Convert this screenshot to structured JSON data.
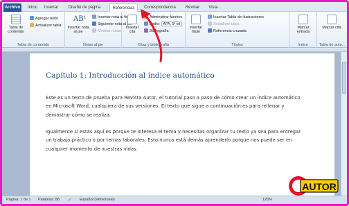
{
  "tabs": [
    {
      "label": "Archivo"
    },
    {
      "label": "Inicio"
    },
    {
      "label": "Insertar"
    },
    {
      "label": "Diseño de página"
    },
    {
      "label": "Referencias"
    },
    {
      "label": "Correspondencia"
    },
    {
      "label": "Revisar"
    },
    {
      "label": "Vista"
    }
  ],
  "ribbon": {
    "toc": {
      "group_label": "Tabla de contenido",
      "table_btn": "Tabla de contenido",
      "add_text": "Agregar texto",
      "update_table": "Actualizar tabla"
    },
    "footnotes": {
      "group_label": "Notas al pie",
      "insert_footnote": "Insertar nota al pie",
      "insert_endnote": "Insertar nota al final",
      "next_footnote": "Siguiente nota al pie",
      "show_notes": "Mostrar notas"
    },
    "citations": {
      "group_label": "Citas y bibliografía",
      "insert_citation": "Insertar cita",
      "manage_sources": "Administrar fuentes",
      "style_label": "Estilo:",
      "style_value": "APA, 5ª ed",
      "bibliography": "Bibliografía"
    },
    "captions": {
      "group_label": "Títulos",
      "insert_caption": "Insertar título",
      "insert_table_figures": "Insertar Tabla de ilustraciones",
      "update_table": "Actualizar tabla",
      "cross_ref": "Referencia cruzada"
    },
    "index": {
      "group_label": "Índice",
      "mark_entry": "Marcar entrada"
    },
    "authorities": {
      "group_label": "Tabla de auto...",
      "mark_citation": "Marcar cita"
    }
  },
  "document": {
    "heading": "Capítulo 1: Introducción al índice automático",
    "paragraphs": [
      "Este es un texto de prueba para Revista Autor, el tutorial paso a paso de cómo crear un índice automático en Microsoft Word, cualquiera de sus versiones. El texto que sigue a continuación es para rellenar y demostrar cómo se realiza.",
      "Igualmente si estás aquí es porque te interesa el tema y necesitas organizar tu texto ya sea para entregar un trabajo práctico o por temas laborales.  Esto nunca está demás aprenderlo porque nos puede ser en cualquier momento de nuestras vidas."
    ]
  },
  "status": {
    "page": "Página: 1 de 1",
    "words": "Palabras: 88",
    "language": "Español (Venezuela)",
    "zoom": "120%"
  },
  "logo": {
    "text": "AUTOR"
  },
  "colors": {
    "border": "#e61ac8",
    "arrow": "#e8102a",
    "heading": "#1f4f88",
    "file_tab": "#2a5699"
  }
}
